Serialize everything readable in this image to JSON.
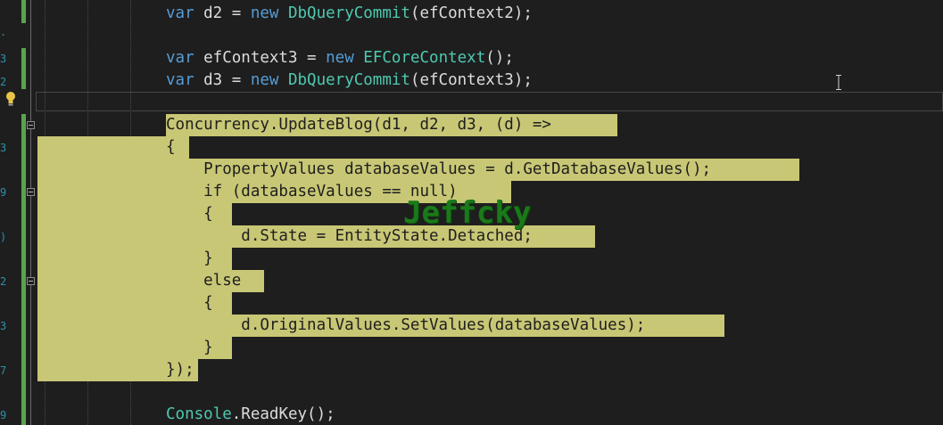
{
  "editor": {
    "lines": [
      {
        "tokens": [
          {
            "t": "var",
            "c": "kw"
          },
          {
            "t": " d2 = ",
            "c": "plain"
          },
          {
            "t": "new",
            "c": "kw"
          },
          {
            "t": " ",
            "c": "plain"
          },
          {
            "t": "DbQueryCommit",
            "c": "type"
          },
          {
            "t": "(efContext2);",
            "c": "plain"
          }
        ]
      },
      {
        "tokens": []
      },
      {
        "tokens": [
          {
            "t": "var",
            "c": "kw"
          },
          {
            "t": " efContext3 = ",
            "c": "plain"
          },
          {
            "t": "new",
            "c": "kw"
          },
          {
            "t": " ",
            "c": "plain"
          },
          {
            "t": "EFCoreContext",
            "c": "type"
          },
          {
            "t": "();",
            "c": "plain"
          }
        ]
      },
      {
        "tokens": [
          {
            "t": "var",
            "c": "kw"
          },
          {
            "t": " d3 = ",
            "c": "plain"
          },
          {
            "t": "new",
            "c": "kw"
          },
          {
            "t": " ",
            "c": "plain"
          },
          {
            "t": "DbQueryCommit",
            "c": "type"
          },
          {
            "t": "(efContext3);",
            "c": "plain"
          }
        ]
      },
      {
        "tokens": []
      },
      {
        "tokens": [
          {
            "t": "Concurrency.UpdateBlog(d1, d2, d3, (d) =>",
            "c": "sel-text"
          }
        ]
      },
      {
        "tokens": [
          {
            "t": "{",
            "c": "sel-text"
          }
        ]
      },
      {
        "tokens": [
          {
            "t": "    PropertyValues databaseValues = d.GetDatabaseValues();",
            "c": "sel-text"
          }
        ]
      },
      {
        "tokens": [
          {
            "t": "    if (databaseValues == null)",
            "c": "sel-text"
          }
        ]
      },
      {
        "tokens": [
          {
            "t": "    {",
            "c": "sel-text"
          }
        ]
      },
      {
        "tokens": [
          {
            "t": "        d.State = EntityState.Detached;",
            "c": "sel-text"
          }
        ]
      },
      {
        "tokens": [
          {
            "t": "    }",
            "c": "sel-text"
          }
        ]
      },
      {
        "tokens": [
          {
            "t": "    else",
            "c": "sel-text"
          }
        ]
      },
      {
        "tokens": [
          {
            "t": "    {",
            "c": "sel-text"
          }
        ]
      },
      {
        "tokens": [
          {
            "t": "        d.OriginalValues.SetValues(databaseValues);",
            "c": "sel-text"
          }
        ]
      },
      {
        "tokens": [
          {
            "t": "    }",
            "c": "sel-text"
          }
        ]
      },
      {
        "tokens": [
          {
            "t": "});",
            "c": "sel-text"
          }
        ]
      },
      {
        "tokens": []
      },
      {
        "tokens": [
          {
            "t": "Console",
            "c": "type"
          },
          {
            "t": ".ReadKey();",
            "c": "plain"
          }
        ]
      }
    ]
  },
  "watermark": "Jeffcky",
  "colors": {
    "background": "#1e1e1e",
    "keyword": "#569cd6",
    "type": "#4ec9b0",
    "selection": "#c8c775",
    "change_bar": "#57a64a"
  },
  "icons": [
    "lightbulb-icon",
    "fold-collapse-icon",
    "text-cursor-icon"
  ]
}
